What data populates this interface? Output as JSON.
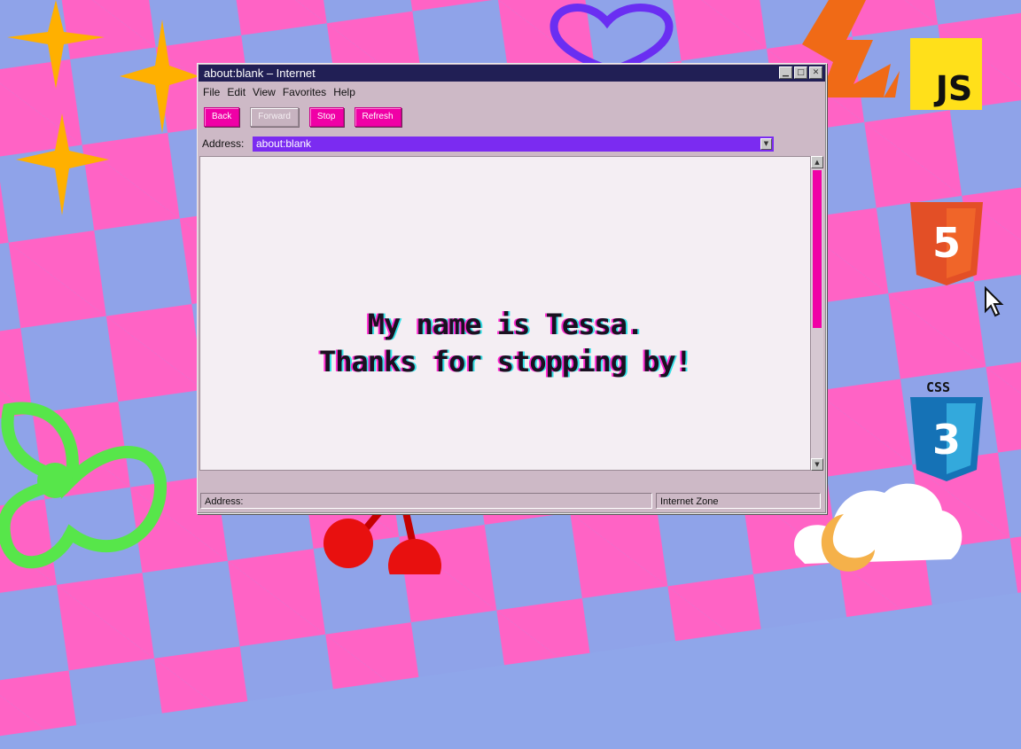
{
  "window": {
    "title": "about:blank – Internet",
    "menu": [
      "File",
      "Edit",
      "View",
      "Favorites",
      "Help"
    ],
    "toolbar": {
      "back": "Back",
      "forward": "Forward",
      "stop": "Stop",
      "refresh": "Refresh"
    },
    "address": {
      "label": "Address:",
      "value": "about:blank"
    },
    "content": {
      "line1": "My name is Tessa.",
      "line2": "Thanks for stopping by!"
    },
    "status": {
      "left": "Address:",
      "right": "Internet Zone"
    }
  },
  "logos": {
    "js": "JS",
    "html": "5",
    "css_label": "CSS",
    "css": "3"
  },
  "colors": {
    "accent_pink": "#f000a6",
    "address_purple": "#7b2bf1",
    "titlebar": "#211f55",
    "bg_pink": "#ff63c5",
    "bg_blue": "#8fa3e9"
  },
  "icons": [
    "sparkle-icon",
    "heart-icon",
    "lightning-icon",
    "cherry-icon",
    "bow-icon",
    "cloud-icon",
    "moon-icon",
    "cursor-icon"
  ]
}
